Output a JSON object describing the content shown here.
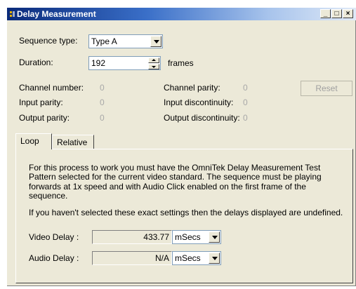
{
  "window": {
    "title": "Delay Measurement",
    "min_icon": "minimize-icon",
    "max_icon": "maximize-icon",
    "close_icon": "close-icon",
    "min_glyph": "_",
    "max_glyph": "□",
    "close_glyph": "×"
  },
  "settings": {
    "sequence_type_label": "Sequence type:",
    "sequence_type_value": "Type A",
    "duration_label": "Duration:",
    "duration_value": "192",
    "duration_unit": "frames"
  },
  "status": {
    "channel_number_label": "Channel number:",
    "channel_number_value": "0",
    "input_parity_label": "Input parity:",
    "input_parity_value": "0",
    "output_parity_label": "Output parity:",
    "output_parity_value": "0",
    "channel_parity_label": "Channel parity:",
    "channel_parity_value": "0",
    "input_discontinuity_label": "Input discontinuity:",
    "input_discontinuity_value": "0",
    "output_discontinuity_label": "Output discontinuity:",
    "output_discontinuity_value": "0",
    "reset_label": "Reset"
  },
  "tabs": [
    {
      "label": "Loop",
      "active": true
    },
    {
      "label": "Relative",
      "active": false
    }
  ],
  "loop": {
    "para1_lines": [
      "For this process to work you must have the OmniTek Delay Measurement Test",
      "Pattern selected for the current video standard. The sequence must be playing",
      "forwards at 1x speed and with Audio Click enabled on the first frame of the",
      "sequence."
    ],
    "para2": "If you haven't selected these exact settings then the delays displayed are undefined.",
    "video_delay_label": "Video Delay :",
    "video_delay_value": "433.77",
    "video_delay_unit": "mSecs",
    "audio_delay_label": "Audio Delay :",
    "audio_delay_value": "N/A",
    "audio_delay_unit": "mSecs"
  },
  "colors": {
    "titlebar_start": "#0a2a7a",
    "window_bg": "#ece9d8",
    "disabled_text": "#a8a8a8"
  }
}
